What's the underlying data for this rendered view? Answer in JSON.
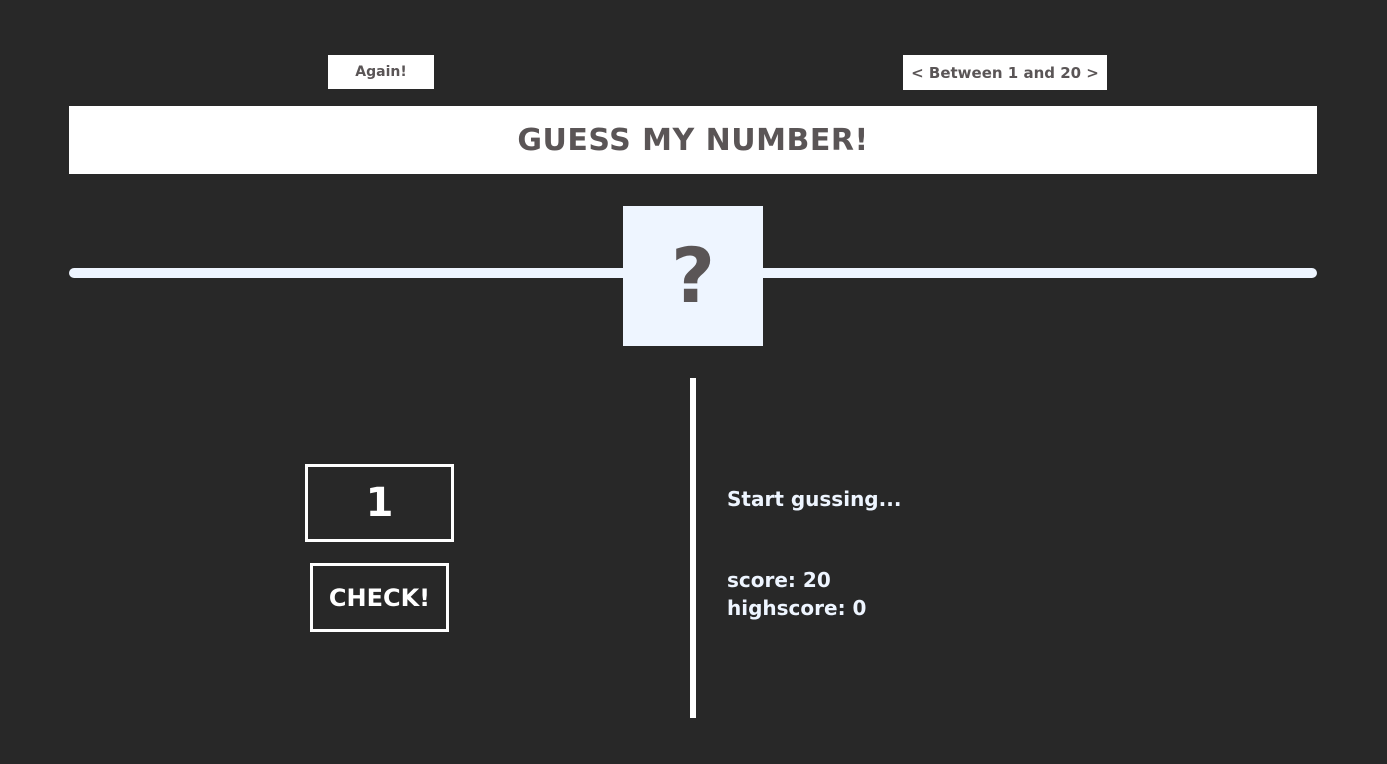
{
  "header": {
    "again_label": "Again!",
    "range_label": "< Between 1 and 20 >",
    "title": "GUESS MY NUMBER!"
  },
  "secret": {
    "display": "?"
  },
  "guess": {
    "value": "1"
  },
  "controls": {
    "check_label": "CHECK!"
  },
  "status": {
    "message": "Start gussing...",
    "score_label": "score:",
    "score_value": "20",
    "highscore_label": "highscore:",
    "highscore_value": "0"
  },
  "colors": {
    "background": "#282828",
    "accent_light": "#eef5ff",
    "text_dark": "#5a5556",
    "white": "#ffffff"
  }
}
